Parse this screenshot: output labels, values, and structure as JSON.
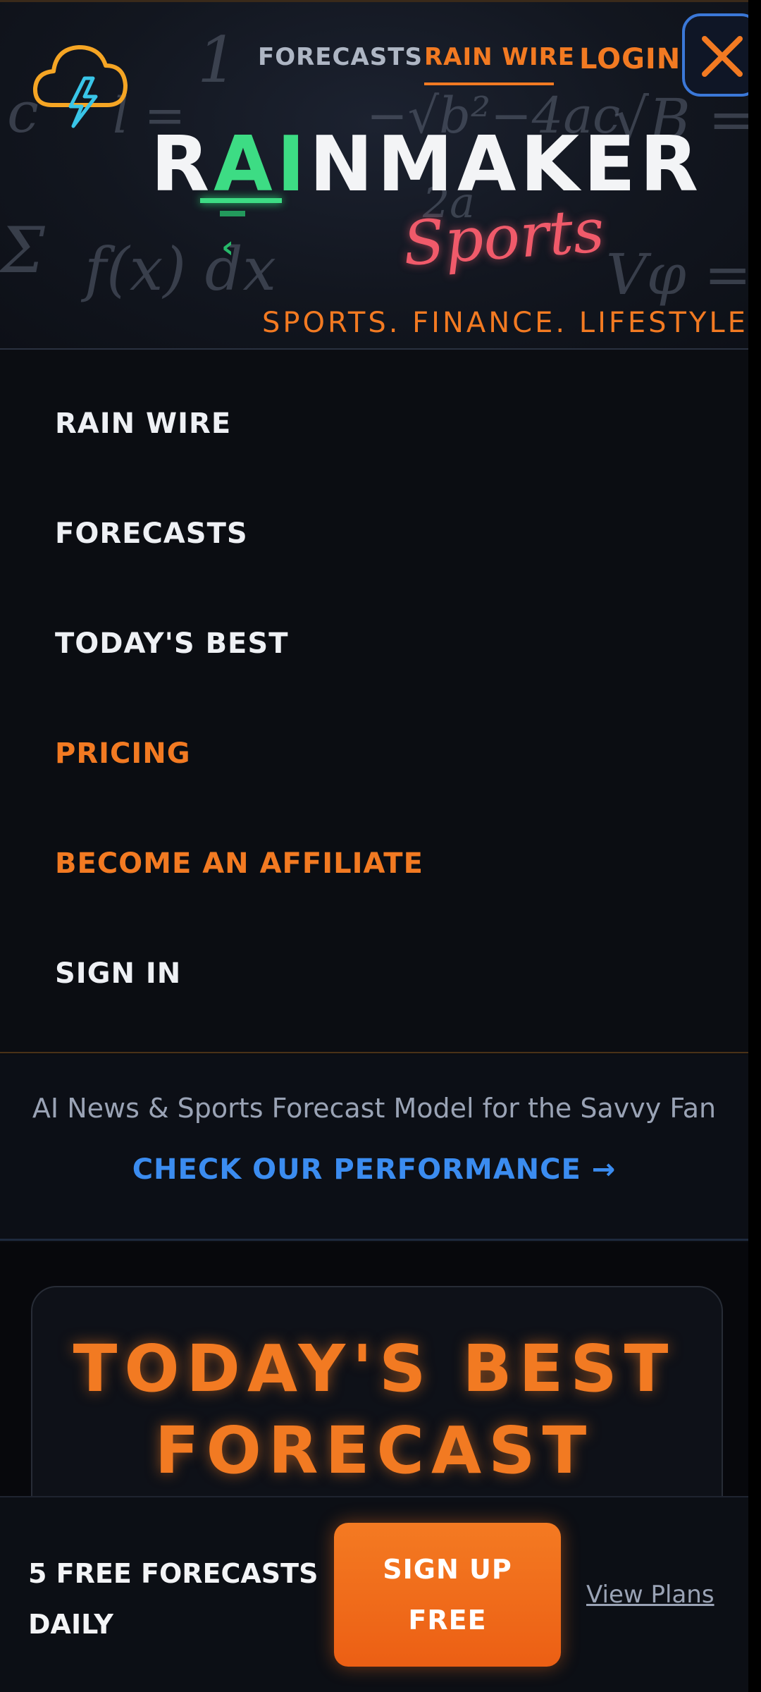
{
  "header": {
    "nav": {
      "forecasts": "FORECASTS",
      "rain_wire": "RAIN WIRE",
      "login": "LOGIN"
    },
    "brand_prefix": "R",
    "brand_ai": "AI",
    "brand_suffix": "NMAKER",
    "brand_script": "Sports",
    "tagline": "SPORTS. FINANCE. LIFESTYLE.",
    "icons": {
      "logo": "storm-cloud-icon",
      "close": "close-icon"
    }
  },
  "menu": {
    "items": [
      {
        "label": "RAIN WIRE",
        "color": "#eef0f4"
      },
      {
        "label": "FORECASTS",
        "color": "#eef0f4"
      },
      {
        "label": "TODAY'S BEST",
        "color": "#eef0f4"
      },
      {
        "label": "PRICING",
        "color": "#f27a22"
      },
      {
        "label": "BECOME AN AFFILIATE",
        "color": "#f27a22"
      },
      {
        "label": "SIGN IN",
        "color": "#eef0f4"
      }
    ]
  },
  "promo": {
    "text": "AI News & Sports Forecast Model for the Savvy Fan",
    "link": "CHECK OUR PERFORMANCE →"
  },
  "best": {
    "title_line1": "TODAY'S BEST",
    "title_line2": "FORECAST"
  },
  "footer": {
    "label_line1": "5 FREE FORECASTS",
    "label_line2": "DAILY",
    "signup_line1": "SIGN UP",
    "signup_line2": "FREE",
    "view_plans": "View Plans"
  },
  "colors": {
    "accent": "#f27a22",
    "ai_green": "#3ddc84",
    "link_blue": "#3b8cf0",
    "script_pink": "#f05a6a"
  }
}
